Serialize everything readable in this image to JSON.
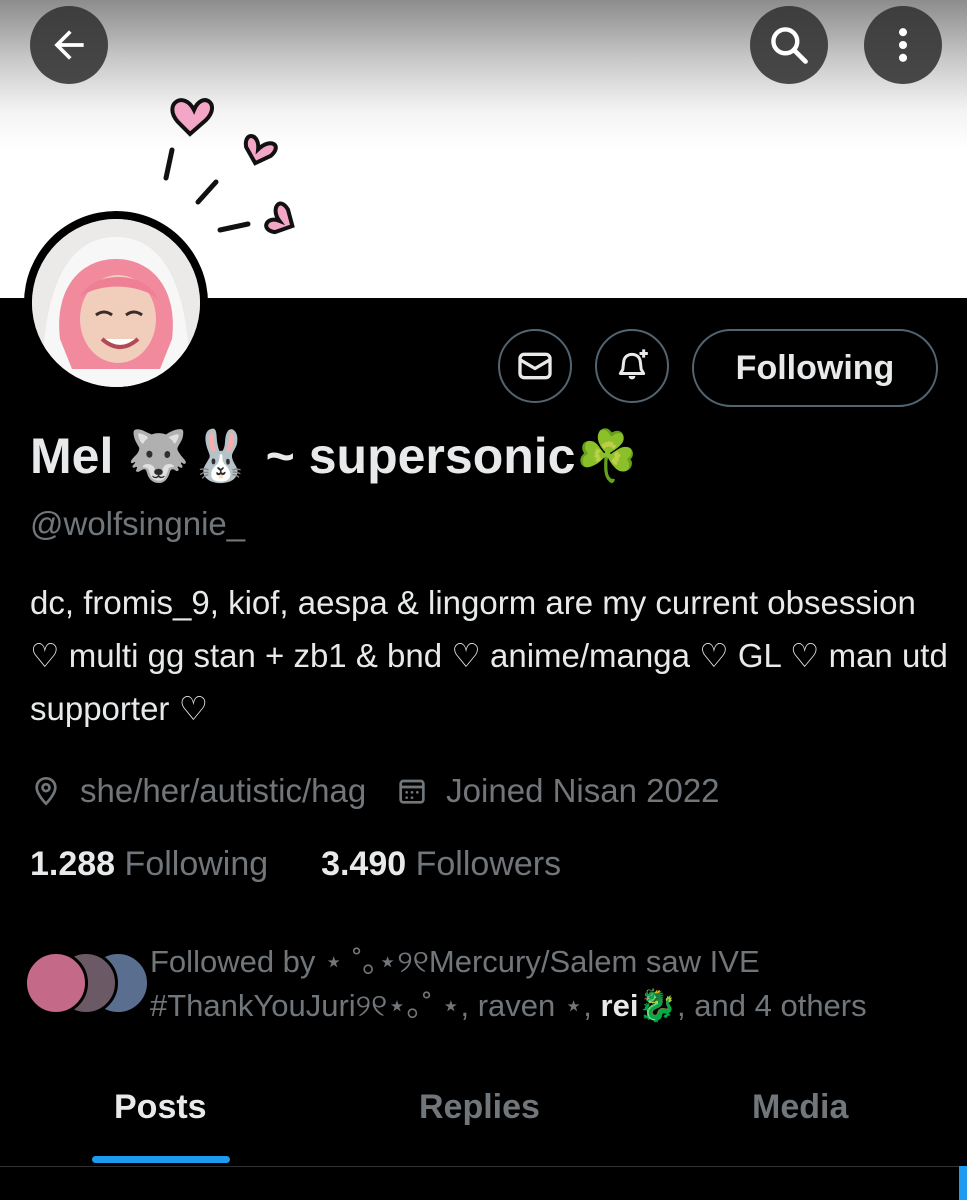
{
  "profile": {
    "display_name": "Mel 🐺🐰 ~ supersonic☘️",
    "handle": "@wolfsingnie_",
    "bio": "dc, fromis_9, kiof, aespa & lingorm are my current obsession ♡ multi gg stan + zb1 & bnd ♡ anime/manga ♡ GL ♡ man utd supporter ♡",
    "location": "she/her/autistic/hag",
    "joined": "Joined Nisan 2022"
  },
  "stats": {
    "following_count": "1.288",
    "following_label": "Following",
    "followers_count": "3.490",
    "followers_label": "Followers"
  },
  "actions": {
    "follow_state": "Following"
  },
  "followed_by": {
    "prefix": "Followed by",
    "names": "⋆ ˚｡⋆୨୧Mercury/Salem saw IVE #ThankYouJuri୨୧⋆｡˚ ⋆, raven ⋆, ",
    "bold_name": "rei🐉",
    "suffix": ", and 4 others"
  },
  "tabs": [
    "Posts",
    "Replies",
    "Media"
  ],
  "icons": {
    "back": "arrow-left-icon",
    "search": "search-icon",
    "more": "more-vertical-icon",
    "message": "envelope-icon",
    "notify": "bell-plus-icon",
    "location": "location-pin-icon",
    "calendar": "calendar-icon"
  },
  "colors": {
    "accent": "#1d9bf0",
    "background": "#000000",
    "text_primary": "#e7e9ea",
    "text_secondary": "#71767b",
    "border": "#536471",
    "heart_pink": "#f4a6c6"
  }
}
